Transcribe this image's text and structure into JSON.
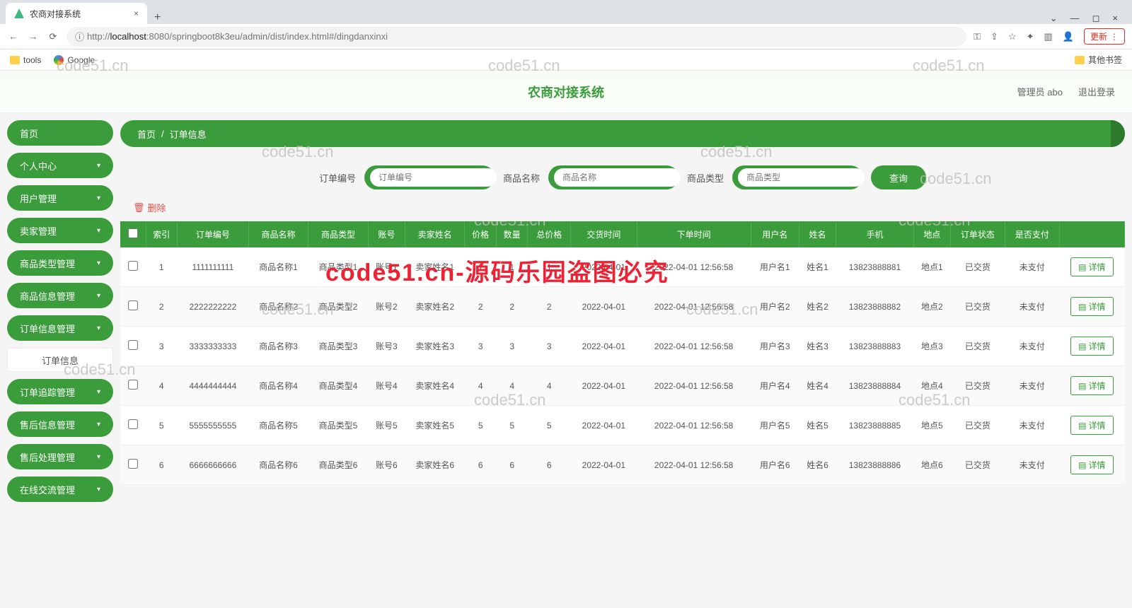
{
  "browser": {
    "tab_title": "农商对接系统",
    "url_host": "localhost",
    "url_port": ":8080",
    "url_path": "/springboot8k3eu/admin/dist/index.html#/dingdanxinxi",
    "update_label": "更新",
    "bookmarks": {
      "tools": "tools",
      "google": "Google",
      "other": "其他书签"
    }
  },
  "header": {
    "title": "农商对接系统",
    "admin": "管理员 abo",
    "logout": "退出登录"
  },
  "sidebar": [
    {
      "label": "首页",
      "chev": false
    },
    {
      "label": "个人中心",
      "chev": true
    },
    {
      "label": "用户管理",
      "chev": true
    },
    {
      "label": "卖家管理",
      "chev": true
    },
    {
      "label": "商品类型管理",
      "chev": true
    },
    {
      "label": "商品信息管理",
      "chev": true
    },
    {
      "label": "订单信息管理",
      "chev": true,
      "sub": "订单信息"
    },
    {
      "label": "订单追踪管理",
      "chev": true
    },
    {
      "label": "售后信息管理",
      "chev": true
    },
    {
      "label": "售后处理管理",
      "chev": true
    },
    {
      "label": "在线交流管理",
      "chev": true
    }
  ],
  "breadcrumb": {
    "home": "首页",
    "current": "订单信息"
  },
  "filters": {
    "f1_label": "订单编号",
    "f1_ph": "订单编号",
    "f2_label": "商品名称",
    "f2_ph": "商品名称",
    "f3_label": "商品类型",
    "f3_ph": "商品类型",
    "search": "查询"
  },
  "delete_label": "删除",
  "columns": [
    "",
    "索引",
    "订单编号",
    "商品名称",
    "商品类型",
    "账号",
    "卖家姓名",
    "价格",
    "数量",
    "总价格",
    "交货时间",
    "下单时间",
    "用户名",
    "姓名",
    "手机",
    "地点",
    "订单状态",
    "是否支付",
    ""
  ],
  "detail_label": "详情",
  "rows": [
    {
      "idx": "1",
      "no": "1111111111",
      "pname": "商品名称1",
      "ptype": "商品类型1",
      "acct": "账号1",
      "seller": "卖家姓名1",
      "price": "1",
      "qty": "1",
      "total": "1",
      "dtime": "2022-04-01",
      "otime": "2022-04-01 12:56:58",
      "user": "用户名1",
      "name": "姓名1",
      "phone": "13823888881",
      "place": "地点1",
      "status": "已交货",
      "pay": "未支付"
    },
    {
      "idx": "2",
      "no": "2222222222",
      "pname": "商品名称2",
      "ptype": "商品类型2",
      "acct": "账号2",
      "seller": "卖家姓名2",
      "price": "2",
      "qty": "2",
      "total": "2",
      "dtime": "2022-04-01",
      "otime": "2022-04-01 12:56:58",
      "user": "用户名2",
      "name": "姓名2",
      "phone": "13823888882",
      "place": "地点2",
      "status": "已交货",
      "pay": "未支付"
    },
    {
      "idx": "3",
      "no": "3333333333",
      "pname": "商品名称3",
      "ptype": "商品类型3",
      "acct": "账号3",
      "seller": "卖家姓名3",
      "price": "3",
      "qty": "3",
      "total": "3",
      "dtime": "2022-04-01",
      "otime": "2022-04-01 12:56:58",
      "user": "用户名3",
      "name": "姓名3",
      "phone": "13823888883",
      "place": "地点3",
      "status": "已交货",
      "pay": "未支付"
    },
    {
      "idx": "4",
      "no": "4444444444",
      "pname": "商品名称4",
      "ptype": "商品类型4",
      "acct": "账号4",
      "seller": "卖家姓名4",
      "price": "4",
      "qty": "4",
      "total": "4",
      "dtime": "2022-04-01",
      "otime": "2022-04-01 12:56:58",
      "user": "用户名4",
      "name": "姓名4",
      "phone": "13823888884",
      "place": "地点4",
      "status": "已交货",
      "pay": "未支付"
    },
    {
      "idx": "5",
      "no": "5555555555",
      "pname": "商品名称5",
      "ptype": "商品类型5",
      "acct": "账号5",
      "seller": "卖家姓名5",
      "price": "5",
      "qty": "5",
      "total": "5",
      "dtime": "2022-04-01",
      "otime": "2022-04-01 12:56:58",
      "user": "用户名5",
      "name": "姓名5",
      "phone": "13823888885",
      "place": "地点5",
      "status": "已交货",
      "pay": "未支付"
    },
    {
      "idx": "6",
      "no": "6666666666",
      "pname": "商品名称6",
      "ptype": "商品类型6",
      "acct": "账号6",
      "seller": "卖家姓名6",
      "price": "6",
      "qty": "6",
      "total": "6",
      "dtime": "2022-04-01",
      "otime": "2022-04-01 12:56:58",
      "user": "用户名6",
      "name": "姓名6",
      "phone": "13823888886",
      "place": "地点6",
      "status": "已交货",
      "pay": "未支付"
    }
  ],
  "watermark": "code51.cn",
  "red_watermark": "code51.cn-源码乐园盗图必究"
}
